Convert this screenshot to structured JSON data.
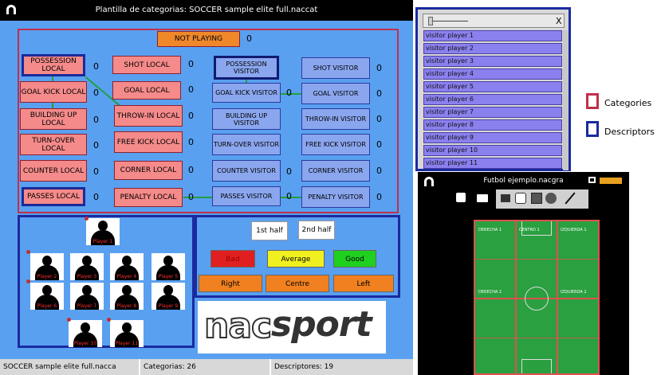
{
  "main_window": {
    "title": "Plantilla de categorias: SOCCER sample elite full.naccat",
    "not_playing": {
      "label": "NOT PLAYING",
      "count": "0"
    },
    "categories": [
      {
        "label": "POSSESSION LOCAL",
        "count": "0"
      },
      {
        "label": "GOAL KICK LOCAL",
        "count": "0"
      },
      {
        "label": "BUILDING UP LOCAL",
        "count": "0"
      },
      {
        "label": "TURN-OVER LOCAL",
        "count": "0"
      },
      {
        "label": "COUNTER LOCAL",
        "count": "0"
      },
      {
        "label": "PASSES LOCAL",
        "count": "0"
      },
      {
        "label": "SHOT LOCAL",
        "count": "0"
      },
      {
        "label": "GOAL LOCAL",
        "count": "0"
      },
      {
        "label": "THROW-IN LOCAL",
        "count": "0"
      },
      {
        "label": "FREE KICK LOCAL",
        "count": "0"
      },
      {
        "label": "CORNER LOCAL",
        "count": "0"
      },
      {
        "label": "PENALTY LOCAL",
        "count": "0"
      }
    ],
    "visitor_categories": [
      {
        "label": "POSSESSION VISITOR",
        "count": "0"
      },
      {
        "label": "GOAL KICK VISITOR",
        "count": "0"
      },
      {
        "label": "BUILDING UP VISITOR",
        "count": "0"
      },
      {
        "label": "TURN-OVER VISITOR",
        "count": "0"
      },
      {
        "label": "COUNTER VISITOR",
        "count": "0"
      },
      {
        "label": "PASSES VISITOR",
        "count": "0"
      },
      {
        "label": "SHOT VISITOR",
        "count": "0"
      },
      {
        "label": "GOAL VISITOR",
        "count": "0"
      },
      {
        "label": "THROW-IN VISITOR",
        "count": "0"
      },
      {
        "label": "FREE KICK VISITOR",
        "count": "0"
      },
      {
        "label": "CORNER VISITOR",
        "count": "0"
      },
      {
        "label": "PENALTY VISITOR",
        "count": "0"
      }
    ],
    "players": [
      "Player 1",
      "Player 2",
      "Player 3",
      "Player 4",
      "Player 5",
      "Player 6",
      "Player 7",
      "Player 8",
      "Player 9",
      "Player 10",
      "Player 11"
    ],
    "halves": [
      "1st half",
      "2nd half"
    ],
    "ratings": [
      {
        "label": "Bad",
        "color": "#e02020"
      },
      {
        "label": "Average",
        "color": "#f0f020"
      },
      {
        "label": "Good",
        "color": "#20d020"
      }
    ],
    "zones": [
      "Right",
      "Centre",
      "Left"
    ],
    "logo_text_1": "nac",
    "logo_text_2": "sport",
    "status": {
      "file": "SOCCER sample elite full.nacca",
      "categories": "Categorias: 26",
      "descriptors": "Descriptores: 19"
    }
  },
  "list_window": {
    "close_label": "X",
    "items": [
      "visitor player 1",
      "visitor player 2",
      "visitor player 3",
      "visitor player 4",
      "visitor player 5",
      "visitor player 6",
      "visitor player 7",
      "visitor player 8",
      "visitor player 9",
      "visitor player 10",
      "visitor player 11"
    ]
  },
  "legend": {
    "categories": {
      "label": "Categories",
      "color": "#c0304a"
    },
    "descriptors": {
      "label": "Descriptors",
      "color": "#1a2aa0"
    }
  },
  "field_window": {
    "title": "Futbol ejemplo.nacgra",
    "zone_labels": {
      "right_top": "DERECHA 1",
      "centre_top": "CENTRO 1",
      "left_top": "IZQUIERDA 1",
      "right_mid": "DERECHA 2",
      "left_mid": "IZQUIERDA 2"
    }
  },
  "colors": {
    "window_bg": "#5aa0f0",
    "category_fill": "#f58a8a",
    "descriptor_fill": "#8aa6ee",
    "field_green": "#2aa040"
  }
}
